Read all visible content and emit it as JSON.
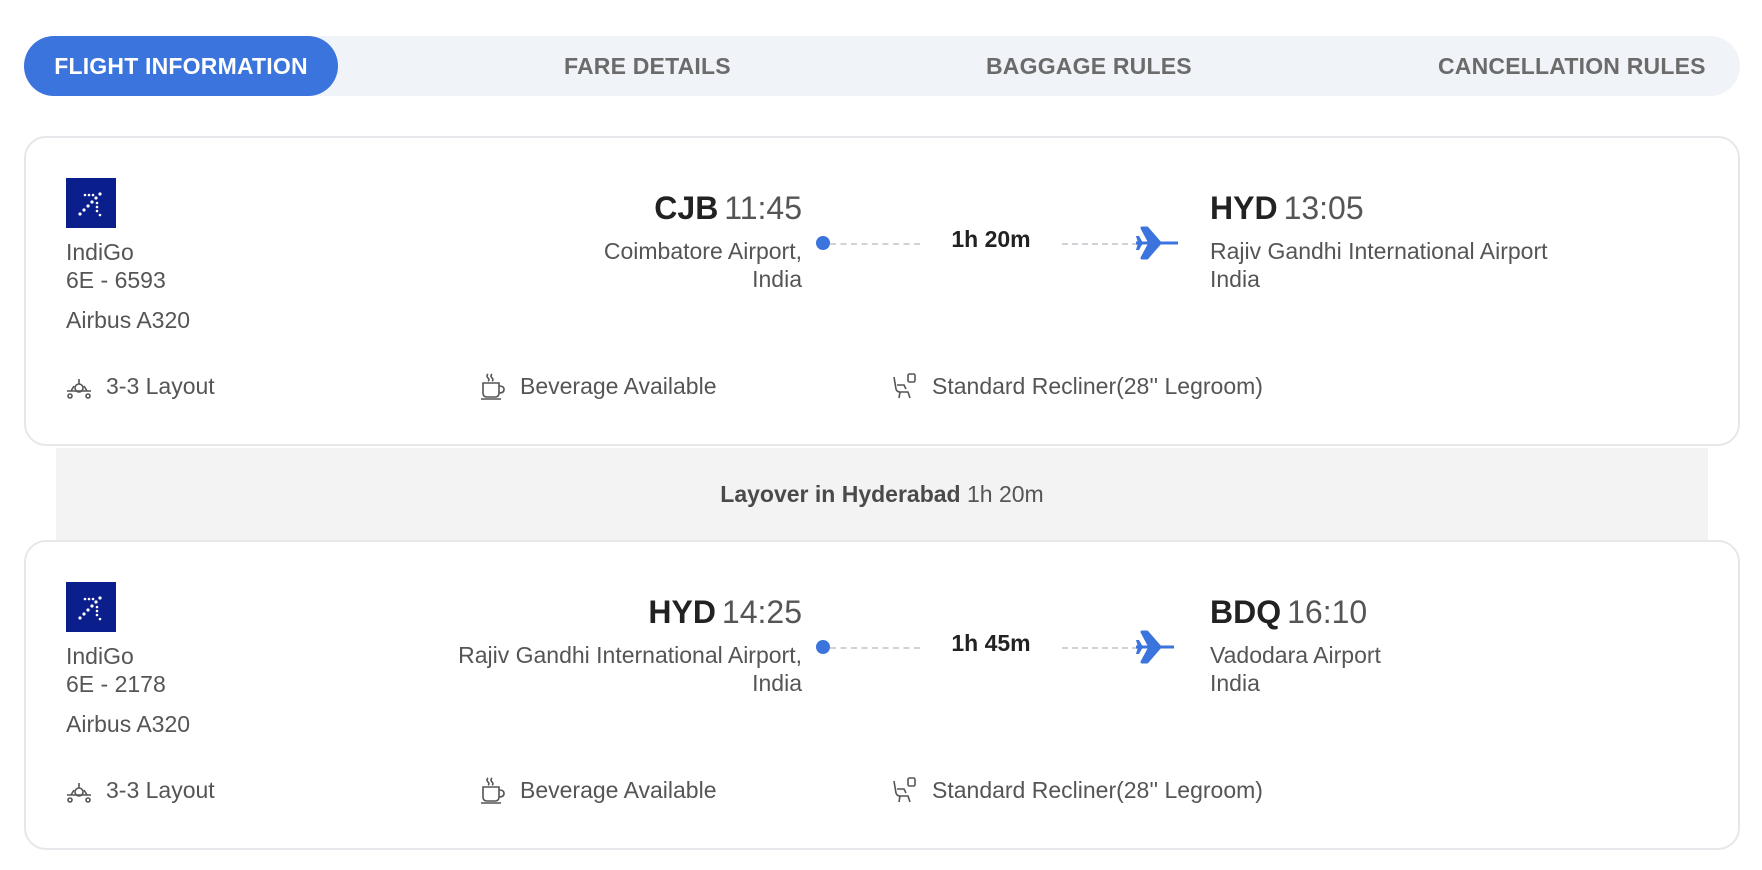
{
  "tabs": [
    {
      "label": "FLIGHT INFORMATION",
      "active": true
    },
    {
      "label": "FARE DETAILS",
      "active": false
    },
    {
      "label": "BAGGAGE RULES",
      "active": false
    },
    {
      "label": "CANCELLATION RULES",
      "active": false
    }
  ],
  "colors": {
    "accent": "#3b74dd",
    "logo_bg": "#0a1e8c",
    "tab_bg": "#f0f3f7",
    "layover_bg": "#f3f3f3"
  },
  "segments": [
    {
      "airline": "IndiGo",
      "flight_no": "6E - 6593",
      "aircraft": "Airbus A320",
      "departure": {
        "code": "CJB",
        "time": "11:45",
        "airport": "Coimbatore Airport,",
        "country": "India"
      },
      "duration": "1h 20m",
      "arrival": {
        "code": "HYD",
        "time": "13:05",
        "airport": "Rajiv Gandhi International Airport",
        "country": "India"
      },
      "amenities": {
        "layout": "3-3 Layout",
        "beverage": "Beverage Available",
        "seat": "Standard Recliner(28'' Legroom)"
      }
    },
    {
      "airline": "IndiGo",
      "flight_no": "6E - 2178",
      "aircraft": "Airbus A320",
      "departure": {
        "code": "HYD",
        "time": "14:25",
        "airport": "Rajiv Gandhi International Airport,",
        "country": "India"
      },
      "duration": "1h 45m",
      "arrival": {
        "code": "BDQ",
        "time": "16:10",
        "airport": "Vadodara Airport",
        "country": "India"
      },
      "amenities": {
        "layout": "3-3 Layout",
        "beverage": "Beverage Available",
        "seat": "Standard Recliner(28'' Legroom)"
      }
    }
  ],
  "layover": {
    "label": "Layover in Hyderabad",
    "duration": "1h 20m"
  },
  "icons": {
    "airline_logo": "indigo-logo",
    "plane": "plane-icon",
    "layout": "seat-layout-icon",
    "beverage": "coffee-cup-icon",
    "seat": "recliner-seat-icon"
  }
}
